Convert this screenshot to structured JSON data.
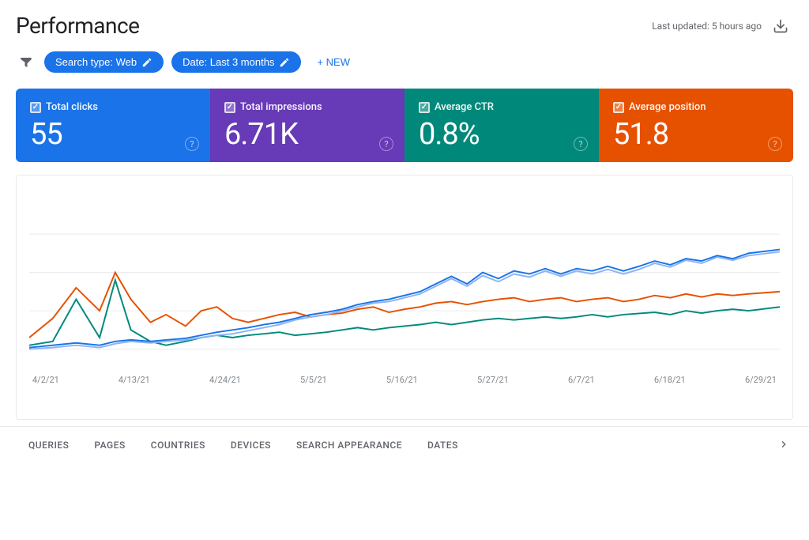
{
  "header": {
    "title": "Performance",
    "last_updated": "Last updated: 5 hours ago"
  },
  "filters": {
    "search_type_label": "Search type: Web",
    "date_label": "Date: Last 3 months",
    "new_label": "+ NEW",
    "filter_icon": "filter-icon"
  },
  "metrics": [
    {
      "id": "total-clicks",
      "label": "Total clicks",
      "value": "55",
      "color": "#1a73e8"
    },
    {
      "id": "total-impressions",
      "label": "Total impressions",
      "value": "6.71K",
      "color": "#673ab7"
    },
    {
      "id": "avg-ctr",
      "label": "Average CTR",
      "value": "0.8%",
      "color": "#00897b"
    },
    {
      "id": "avg-position",
      "label": "Average position",
      "value": "51.8",
      "color": "#e65100"
    }
  ],
  "chart": {
    "x_labels": [
      "4/2/21",
      "4/13/21",
      "4/24/21",
      "5/5/21",
      "5/16/21",
      "5/27/21",
      "6/7/21",
      "6/18/21",
      "6/29/21"
    ],
    "series": {
      "orange": "#e65100",
      "teal": "#00897b",
      "blue_dark": "#1a73e8",
      "blue_light": "#8ab4f8"
    }
  },
  "bottom_tabs": [
    {
      "label": "QUERIES",
      "active": false
    },
    {
      "label": "PAGES",
      "active": false
    },
    {
      "label": "COUNTRIES",
      "active": false
    },
    {
      "label": "DEVICES",
      "active": false
    },
    {
      "label": "SEARCH APPEARANCE",
      "active": false
    },
    {
      "label": "DATES",
      "active": false
    }
  ]
}
